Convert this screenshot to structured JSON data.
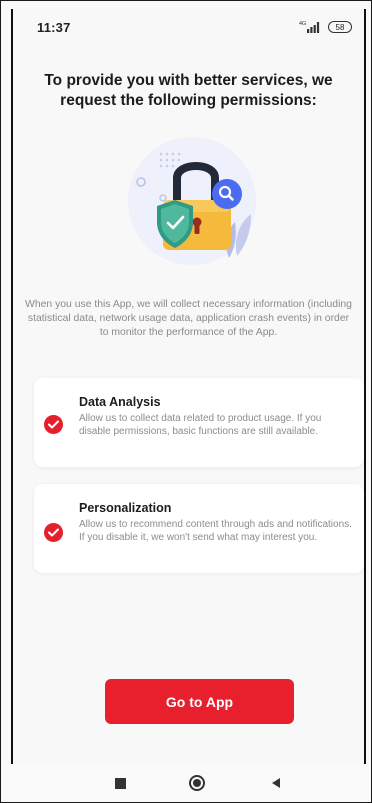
{
  "status_bar": {
    "time": "11:37",
    "network": "4G",
    "battery": "58"
  },
  "headline": "To provide you with better services, we request the following permissions:",
  "hero": {
    "icon": "padlock-shield-magnifier-illustration"
  },
  "intro": "When you use this App, we will collect necessary information (including statistical data, network usage data, application crash events) in order to monitor the performance of the App.",
  "permissions": [
    {
      "title": "Data Analysis",
      "description": "Allow us to collect data related to product usage. If you disable permissions, basic functions are still available.",
      "checked": true
    },
    {
      "title": "Personalization",
      "description": "Allow us to recommend content through ads and notifications. If you disable it, we won't send what may interest you.",
      "checked": true
    }
  ],
  "cta": {
    "label": "Go to App"
  },
  "nav": {
    "recents_icon": "square-icon",
    "home_icon": "circle-icon",
    "back_icon": "triangle-left-icon"
  },
  "colors": {
    "accent": "#e8202d",
    "title_text": "#1c1c1c",
    "muted_text": "#8a8a8a",
    "card_bg": "#ffffff",
    "page_bg": "#f8f8f8"
  }
}
